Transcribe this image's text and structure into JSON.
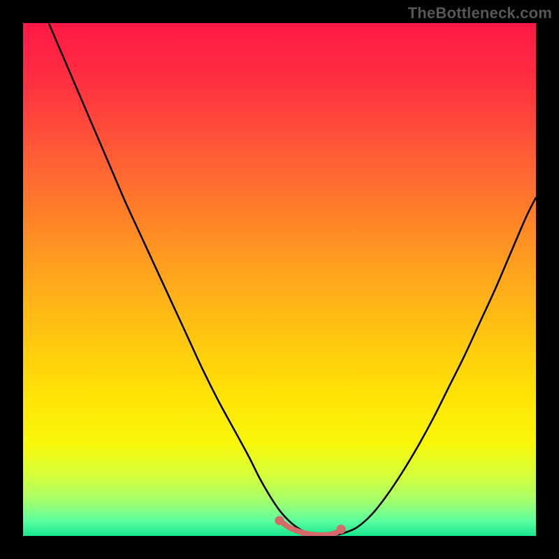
{
  "watermark": "TheBottleneck.com",
  "chart_data": {
    "type": "line",
    "title": "",
    "xlabel": "",
    "ylabel": "",
    "xlim": [
      0,
      100
    ],
    "ylim": [
      0,
      100
    ],
    "grid": false,
    "legend": false,
    "background_gradient": {
      "stops": [
        {
          "pos": 0.0,
          "color": "#ff1846"
        },
        {
          "pos": 0.12,
          "color": "#ff3140"
        },
        {
          "pos": 0.25,
          "color": "#ff5a36"
        },
        {
          "pos": 0.38,
          "color": "#ff8228"
        },
        {
          "pos": 0.5,
          "color": "#ffa81c"
        },
        {
          "pos": 0.62,
          "color": "#ffc80f"
        },
        {
          "pos": 0.73,
          "color": "#ffe405"
        },
        {
          "pos": 0.82,
          "color": "#f8f70a"
        },
        {
          "pos": 0.88,
          "color": "#d7ff38"
        },
        {
          "pos": 0.93,
          "color": "#a6ff6a"
        },
        {
          "pos": 0.97,
          "color": "#5dff9e"
        },
        {
          "pos": 1.0,
          "color": "#17e78e"
        }
      ]
    },
    "series": [
      {
        "name": "bottleneck-curve",
        "stroke": "#000000",
        "stroke_width": 2,
        "x": [
          5,
          8,
          11,
          14,
          17,
          20,
          23,
          26,
          29,
          32,
          35,
          38,
          41,
          44,
          46,
          48,
          50,
          52,
          54,
          56,
          58,
          60,
          62,
          65,
          68,
          71,
          74,
          77,
          80,
          83,
          86,
          89,
          92,
          95,
          98,
          100
        ],
        "y": [
          100,
          93,
          86,
          79,
          72,
          65,
          58.5,
          52,
          45.5,
          39,
          32.5,
          26.5,
          21,
          15.5,
          11.5,
          8,
          5,
          2.8,
          1.3,
          0.4,
          0.05,
          0.05,
          0.4,
          1.6,
          4.2,
          8.0,
          12.5,
          17.5,
          23,
          29,
          35,
          41.5,
          48,
          55,
          62,
          66
        ]
      },
      {
        "name": "bottom-marker",
        "type": "scatter",
        "stroke": "#d46a6a",
        "fill": "#d46a6a",
        "marker_radius": 5,
        "x": [
          50,
          52,
          54,
          55,
          56,
          57,
          58,
          59,
          60,
          61,
          62
        ],
        "y": [
          3.0,
          1.6,
          0.8,
          0.5,
          0.3,
          0.2,
          0.15,
          0.2,
          0.3,
          0.6,
          1.3
        ]
      }
    ]
  }
}
